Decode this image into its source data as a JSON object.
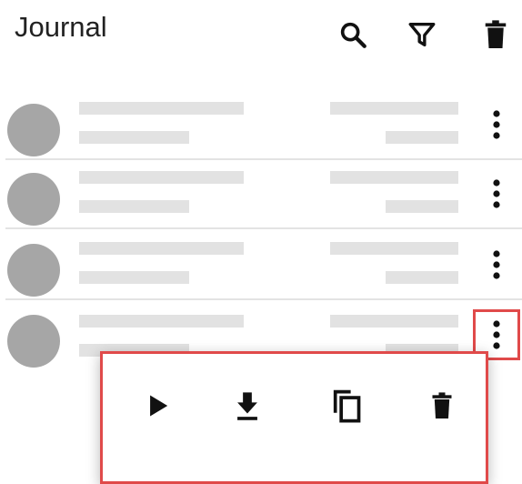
{
  "header": {
    "title": "Journal",
    "icons": [
      "search-icon",
      "filter-icon",
      "delete-icon"
    ]
  },
  "list": {
    "row_count": 4,
    "items": [
      {
        "state": "loading-placeholder"
      },
      {
        "state": "loading-placeholder"
      },
      {
        "state": "loading-placeholder"
      },
      {
        "state": "loading-placeholder",
        "menu_open": true
      }
    ]
  },
  "context_menu": {
    "items": [
      "play-icon",
      "download-icon",
      "copy-icon",
      "delete-icon"
    ]
  },
  "colors": {
    "placeholder": "#e2e2e2",
    "avatar": "#a6a6a6",
    "highlight": "#e04a4a"
  }
}
